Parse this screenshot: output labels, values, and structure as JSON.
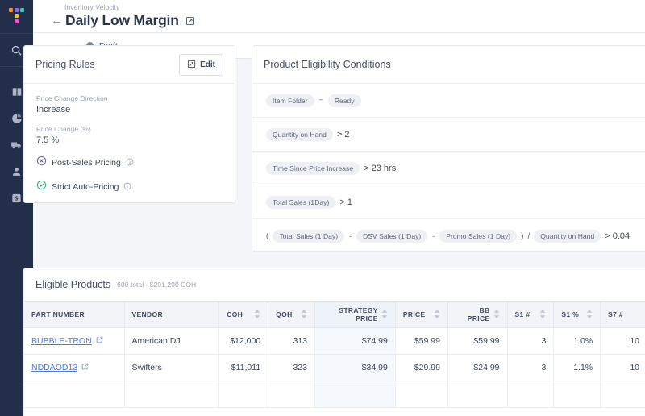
{
  "sidebar": {
    "logo_name": "tophatter-logo",
    "logo_colors": [
      "#f0922b",
      "#8d6fe0",
      "#3fc8c0",
      "#f2c037",
      "#e858c8"
    ],
    "search_icon": "search-icon",
    "items": [
      {
        "icon": "book-icon",
        "name": "sidebar-item-catalog"
      },
      {
        "icon": "pie-chart-icon",
        "name": "sidebar-item-analytics"
      },
      {
        "icon": "truck-icon",
        "name": "sidebar-item-shipping"
      },
      {
        "icon": "user-icon",
        "name": "sidebar-item-customers"
      },
      {
        "icon": "dollar-badge-icon",
        "name": "sidebar-item-pricing"
      }
    ]
  },
  "header": {
    "breadcrumb": "Inventory Velocity",
    "back_icon": "back-arrow-icon",
    "title": "Daily Low Margin",
    "title_edit_icon": "edit-pencil-icon"
  },
  "status": {
    "dot_color": "#7d8597",
    "label": "Draft"
  },
  "pricing_rules": {
    "title": "Pricing Rules",
    "edit_label": "Edit",
    "edit_icon": "edit-pencil-icon",
    "fields": [
      {
        "label": "Price Change Direction",
        "value": "Increase"
      },
      {
        "label": "Price Change (%)",
        "value": "7.5 %"
      }
    ],
    "toggles": [
      {
        "label": "Post-Sales Pricing",
        "state": "off",
        "icon": "x-circle-icon",
        "color": "#5f6880",
        "info_icon": "info-icon"
      },
      {
        "label": "Strict Auto-Pricing",
        "state": "on",
        "icon": "check-circle-icon",
        "color": "#2eaf6d",
        "info_icon": "info-icon"
      }
    ]
  },
  "eligibility": {
    "title": "Product Eligibility Conditions",
    "conditions": [
      {
        "tokens": [
          {
            "type": "pill",
            "text": "Item Folder"
          },
          {
            "type": "op",
            "text": "="
          },
          {
            "type": "pill",
            "text": "Ready"
          }
        ]
      },
      {
        "tokens": [
          {
            "type": "pill",
            "text": "Quantity on Hand"
          },
          {
            "type": "val",
            "text": "> 2"
          }
        ]
      },
      {
        "tokens": [
          {
            "type": "pill",
            "text": "Time Since Price Increase"
          },
          {
            "type": "val",
            "text": "> 23 hrs"
          }
        ]
      },
      {
        "tokens": [
          {
            "type": "pill",
            "text": "Total Sales (1Day)"
          },
          {
            "type": "val",
            "text": "> 1"
          }
        ]
      },
      {
        "tokens": [
          {
            "type": "paren",
            "text": "("
          },
          {
            "type": "pill",
            "text": "Total Sales (1 Day)"
          },
          {
            "type": "op",
            "text": "-"
          },
          {
            "type": "pill",
            "text": "DSV Sales (1 Day)"
          },
          {
            "type": "op",
            "text": "-"
          },
          {
            "type": "pill",
            "text": "Promo Sales (1 Day)"
          },
          {
            "type": "paren",
            "text": ")"
          },
          {
            "type": "paren",
            "text": "/"
          },
          {
            "type": "pill",
            "text": "Quantity on Hand"
          },
          {
            "type": "val",
            "text": "> 0.04"
          }
        ]
      }
    ]
  },
  "products_table": {
    "title": "Eligible Products",
    "subtitle": "600 total - $201,200 COH",
    "columns": [
      {
        "label": "PART NUMBER",
        "align": "left",
        "sortable": false,
        "highlight": false
      },
      {
        "label": "VENDOR",
        "align": "left",
        "sortable": false,
        "highlight": false
      },
      {
        "label": "COH",
        "align": "right",
        "sortable": true,
        "highlight": false
      },
      {
        "label": "QOH",
        "align": "right",
        "sortable": true,
        "highlight": false
      },
      {
        "label": "STRATEGY PRICE",
        "align": "right",
        "sortable": true,
        "highlight": true
      },
      {
        "label": "PRICE",
        "align": "right",
        "sortable": true,
        "highlight": false
      },
      {
        "label": "BB PRICE",
        "align": "right",
        "sortable": true,
        "highlight": false
      },
      {
        "label": "S1 #",
        "align": "right",
        "sortable": true,
        "highlight": false
      },
      {
        "label": "S1 %",
        "align": "right",
        "sortable": true,
        "highlight": false
      },
      {
        "label": "S7 #",
        "align": "right",
        "sortable": false,
        "highlight": false
      }
    ],
    "rows": [
      {
        "part_number": "BUBBLE-TRON",
        "link_icon": "external-link-icon",
        "vendor": "American DJ",
        "coh": "$12,000",
        "qoh": "313",
        "strategy_price": "$74.99",
        "price": "$59.99",
        "bb_price": "$59.99",
        "s1_num": "3",
        "s1_pct": "1.0%",
        "s7_num": "10"
      },
      {
        "part_number": "NDDAOD13",
        "link_icon": "external-link-icon",
        "vendor": "Swifters",
        "coh": "$11,011",
        "qoh": "323",
        "strategy_price": "$34.99",
        "price": "$29.99",
        "bb_price": "$24.99",
        "s1_num": "3",
        "s1_pct": "1.1%",
        "s7_num": "10"
      },
      {
        "part_number": "",
        "link_icon": "",
        "vendor": "",
        "coh": "",
        "qoh": "",
        "strategy_price": "",
        "price": "",
        "bb_price": "",
        "s1_num": "",
        "s1_pct": "",
        "s7_num": ""
      }
    ]
  },
  "colors": {
    "sidebar_bg": "#232e4a",
    "page_bg": "#f4f5f9",
    "accent_link": "#4c7be0",
    "strategy_col_bg": "#f5f8fd",
    "green": "#2eaf6d"
  }
}
